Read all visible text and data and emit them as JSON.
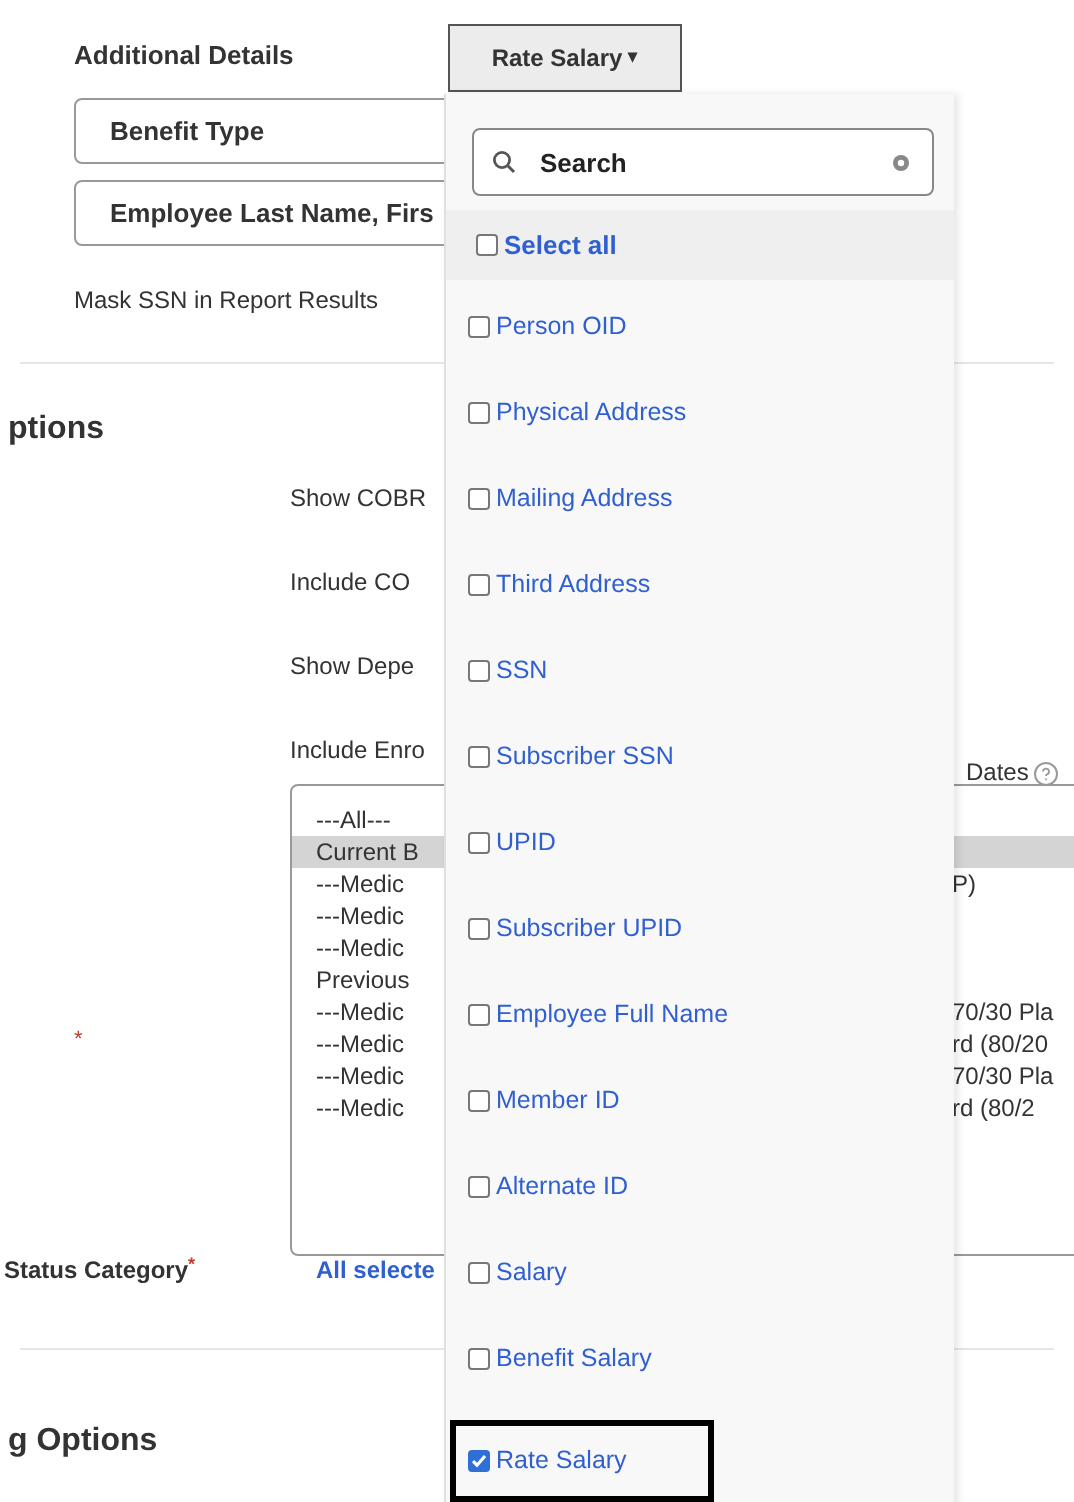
{
  "additional_details": {
    "label": "Additional Details",
    "fields": [
      {
        "value": "Benefit Type"
      },
      {
        "value": "Employee Last Name, Firs"
      }
    ],
    "mask_ssn_label": "Mask SSN in Report Results"
  },
  "options_section": {
    "heading": "ptions",
    "labels": [
      "Show COBR",
      "Include CO",
      "Show Depe",
      "Include Enro"
    ],
    "dates_label": "Dates",
    "required_mark": "*",
    "listbox": [
      {
        "text": "---All---",
        "selected": false
      },
      {
        "text": "Current B",
        "selected": true
      },
      {
        "text": "---Medic",
        "right_text": "P)",
        "selected": false
      },
      {
        "text": "---Medic",
        "selected": false
      },
      {
        "text": "---Medic",
        "selected": false
      },
      {
        "text": "Previous",
        "selected": false
      },
      {
        "text": "---Medic",
        "right_text": "70/30 Pla",
        "selected": false
      },
      {
        "text": "---Medic",
        "right_text": "rd (80/20",
        "selected": false
      },
      {
        "text": "---Medic",
        "right_text": "70/30 Pla",
        "selected": false
      },
      {
        "text": "---Medic",
        "right_text": "rd (80/2",
        "selected": false
      }
    ],
    "status_category_label": "Status Category",
    "status_category_required": "*",
    "status_category_value": "All selecte"
  },
  "next_section": {
    "heading": "g Options"
  },
  "column_dropdown": {
    "button_label": "Rate Salary",
    "caret": "▾",
    "search": {
      "placeholder": "Search"
    },
    "select_all": {
      "label": "Select all",
      "checked": false
    },
    "items": [
      {
        "label": "Person OID",
        "checked": false,
        "focused": false
      },
      {
        "label": "Physical Address",
        "checked": false,
        "focused": false
      },
      {
        "label": "Mailing Address",
        "checked": false,
        "focused": false
      },
      {
        "label": "Third Address",
        "checked": false,
        "focused": false
      },
      {
        "label": "SSN",
        "checked": false,
        "focused": false
      },
      {
        "label": "Subscriber SSN",
        "checked": false,
        "focused": false
      },
      {
        "label": "UPID",
        "checked": false,
        "focused": false
      },
      {
        "label": "Subscriber UPID",
        "checked": false,
        "focused": false
      },
      {
        "label": "Employee Full Name",
        "checked": false,
        "focused": false
      },
      {
        "label": "Member ID",
        "checked": false,
        "focused": false
      },
      {
        "label": "Alternate ID",
        "checked": false,
        "focused": false
      },
      {
        "label": "Salary",
        "checked": false,
        "focused": false
      },
      {
        "label": "Benefit Salary",
        "checked": false,
        "focused": false
      },
      {
        "label": "Rate Salary",
        "checked": true,
        "focused": true
      }
    ]
  }
}
